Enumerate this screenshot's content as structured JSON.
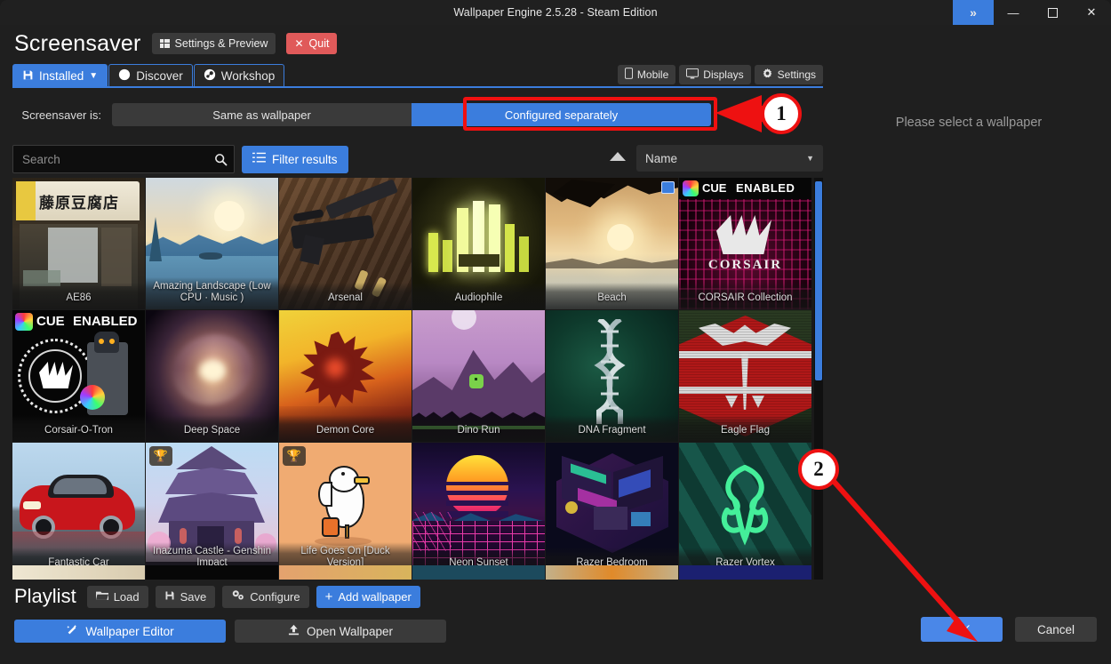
{
  "window": {
    "title": "Wallpaper Engine 2.5.28 - Steam Edition",
    "expand_icon": "chevrons-right-icon",
    "minimize_icon": "minimize-icon",
    "maximize_icon": "maximize-icon",
    "close_icon": "close-icon"
  },
  "header": {
    "page_title": "Screensaver",
    "settings_preview_label": "Settings & Preview",
    "quit_label": "Quit"
  },
  "tabs": [
    {
      "label": "Installed",
      "icon": "save-disk-icon",
      "active": true,
      "caret": "▾"
    },
    {
      "label": "Discover",
      "icon": "compass-icon",
      "active": false
    },
    {
      "label": "Workshop",
      "icon": "steam-icon",
      "active": false
    }
  ],
  "top_right_buttons": [
    {
      "label": "Mobile",
      "icon": "phone-icon"
    },
    {
      "label": "Displays",
      "icon": "monitor-icon"
    },
    {
      "label": "Settings",
      "icon": "gear-icon"
    }
  ],
  "screensaver_mode": {
    "label": "Screensaver is:",
    "options": [
      {
        "label": "Same as wallpaper",
        "active": false
      },
      {
        "label": "Configured separately",
        "active": true
      }
    ]
  },
  "search": {
    "placeholder": "Search",
    "value": "",
    "icon": "search-icon",
    "filter_label": "Filter results",
    "filter_icon": "filter-list-icon"
  },
  "sort": {
    "direction_icon": "sort-ascending-triangle-icon",
    "value": "Name",
    "caret_icon": "chevron-down-icon"
  },
  "right_pane": {
    "message": "Please select a wallpaper"
  },
  "grid": {
    "scrollbar_name": "grid-scrollbar",
    "items": [
      {
        "title": "AE86",
        "art": "ae86",
        "badge": null,
        "selected": false
      },
      {
        "title": "Amazing Landscape (Low CPU · Music )",
        "art": "landscape",
        "badge": null,
        "selected": false
      },
      {
        "title": "Arsenal",
        "art": "arsenal",
        "badge": null,
        "selected": false
      },
      {
        "title": "Audiophile",
        "art": "audiophile",
        "badge": null,
        "selected": false
      },
      {
        "title": "Beach",
        "art": "beach",
        "badge": "check",
        "selected": false
      },
      {
        "title": "CORSAIR Collection",
        "art": "corsair",
        "badge": null,
        "selected": false
      },
      {
        "title": "Corsair-O-Tron",
        "art": "corsairotron",
        "badge": null,
        "selected": false
      },
      {
        "title": "Deep Space",
        "art": "deepspace",
        "badge": null,
        "selected": false
      },
      {
        "title": "Demon Core",
        "art": "demoncore",
        "badge": null,
        "selected": false
      },
      {
        "title": "Dino Run",
        "art": "dinorun",
        "badge": null,
        "selected": false
      },
      {
        "title": "DNA Fragment",
        "art": "dna",
        "badge": null,
        "selected": false
      },
      {
        "title": "Eagle Flag",
        "art": "eagle",
        "badge": null,
        "selected": false
      },
      {
        "title": "Fantastic Car",
        "art": "car",
        "badge": null,
        "selected": false
      },
      {
        "title": "Inazuma Castle - Genshin Impact",
        "art": "inazuma",
        "badge": "trophy",
        "selected": false
      },
      {
        "title": "Life Goes On [Duck Version]",
        "art": "duck",
        "badge": "trophy",
        "selected": false
      },
      {
        "title": "Neon Sunset",
        "art": "neon",
        "badge": null,
        "selected": false
      },
      {
        "title": "Razer Bedroom",
        "art": "razerbed",
        "badge": null,
        "selected": false
      },
      {
        "title": "Razer Vortex",
        "art": "razervortex",
        "badge": null,
        "selected": true
      }
    ]
  },
  "playlist": {
    "title": "Playlist",
    "buttons": [
      {
        "label": "Load",
        "icon": "folder-open-icon",
        "primary": false
      },
      {
        "label": "Save",
        "icon": "save-disk-icon",
        "primary": false
      },
      {
        "label": "Configure",
        "icon": "gears-icon",
        "primary": false
      },
      {
        "label": "Add wallpaper",
        "icon": "plus-icon",
        "primary": true
      }
    ],
    "wide_buttons": [
      {
        "label": "Wallpaper Editor",
        "icon": "wand-icon",
        "primary": true
      },
      {
        "label": "Open Wallpaper",
        "icon": "upload-icon",
        "primary": false
      }
    ]
  },
  "dialog": {
    "ok_label": "OK",
    "cancel_label": "Cancel"
  },
  "annotations": {
    "marker_one": "1",
    "marker_two": "2",
    "color": "#ee1111"
  }
}
